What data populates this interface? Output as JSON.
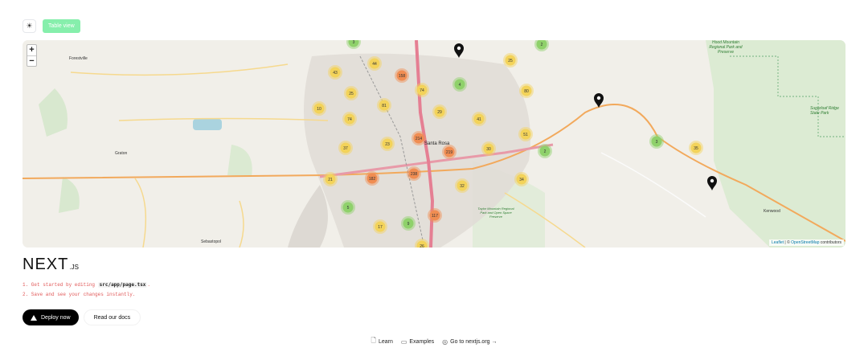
{
  "toolbar": {
    "theme_icon": "sun-icon",
    "table_view_label": "Table view",
    "table_view_color": "#86efac"
  },
  "map": {
    "zoom_in": "+",
    "zoom_out": "−",
    "attribution": {
      "leaflet": "Leaflet",
      "separator": "| ©",
      "osm": "OpenStreetMap",
      "suffix": "contributors"
    },
    "place_labels": [
      {
        "name": "Forestville"
      },
      {
        "name": "Santa Rosa"
      },
      {
        "name": "Graton"
      },
      {
        "name": "Sebastopol"
      },
      {
        "name": "Kenwood"
      },
      {
        "name": "Taylor Mountain Regional Park and Open Space Preserve"
      },
      {
        "name": "Sugarloaf Ridge State Park"
      },
      {
        "name": "Hood Mountain Regional Park and Preserve"
      }
    ],
    "clusters": [
      {
        "count": "3",
        "level": "low"
      },
      {
        "count": "44",
        "level": "mid"
      },
      {
        "count": "43",
        "level": "mid"
      },
      {
        "count": "158",
        "level": "high"
      },
      {
        "count": "74",
        "level": "mid"
      },
      {
        "count": "4",
        "level": "low"
      },
      {
        "count": "25",
        "level": "mid"
      },
      {
        "count": "2",
        "level": "low"
      },
      {
        "count": "25",
        "level": "mid"
      },
      {
        "count": "80",
        "level": "mid"
      },
      {
        "count": "10",
        "level": "mid"
      },
      {
        "count": "81",
        "level": "mid"
      },
      {
        "count": "29",
        "level": "mid"
      },
      {
        "count": "41",
        "level": "mid"
      },
      {
        "count": "74",
        "level": "mid"
      },
      {
        "count": "51",
        "level": "mid"
      },
      {
        "count": "214",
        "level": "high"
      },
      {
        "count": "23",
        "level": "mid"
      },
      {
        "count": "37",
        "level": "mid"
      },
      {
        "count": "219",
        "level": "high"
      },
      {
        "count": "30",
        "level": "mid"
      },
      {
        "count": "2",
        "level": "low"
      },
      {
        "count": "3",
        "level": "low"
      },
      {
        "count": "35",
        "level": "mid"
      },
      {
        "count": "21",
        "level": "mid"
      },
      {
        "count": "182",
        "level": "high"
      },
      {
        "count": "238",
        "level": "high"
      },
      {
        "count": "34",
        "level": "mid"
      },
      {
        "count": "32",
        "level": "mid"
      },
      {
        "count": "5",
        "level": "low"
      },
      {
        "count": "117",
        "level": "high"
      },
      {
        "count": "9",
        "level": "low"
      },
      {
        "count": "17",
        "level": "mid"
      },
      {
        "count": "26",
        "level": "mid"
      }
    ],
    "cluster_colors": {
      "low": "#8fd16b",
      "mid": "#f3d35a",
      "high": "#f08d52"
    },
    "marker_icon": "map-pin-icon",
    "marker_count": 3
  },
  "logo": {
    "text": "NEXT",
    "suffix": ".JS"
  },
  "steps": [
    {
      "prefix": "1. Get started by editing ",
      "code": "src/app/page.tsx",
      "suffix": "."
    },
    {
      "prefix": "2. Save and see your changes instantly.",
      "code": "",
      "suffix": ""
    }
  ],
  "actions": {
    "deploy_label": "Deploy now",
    "docs_label": "Read our docs"
  },
  "footer": {
    "learn": "Learn",
    "examples": "Examples",
    "nextjs": "Go to nextjs.org →"
  }
}
